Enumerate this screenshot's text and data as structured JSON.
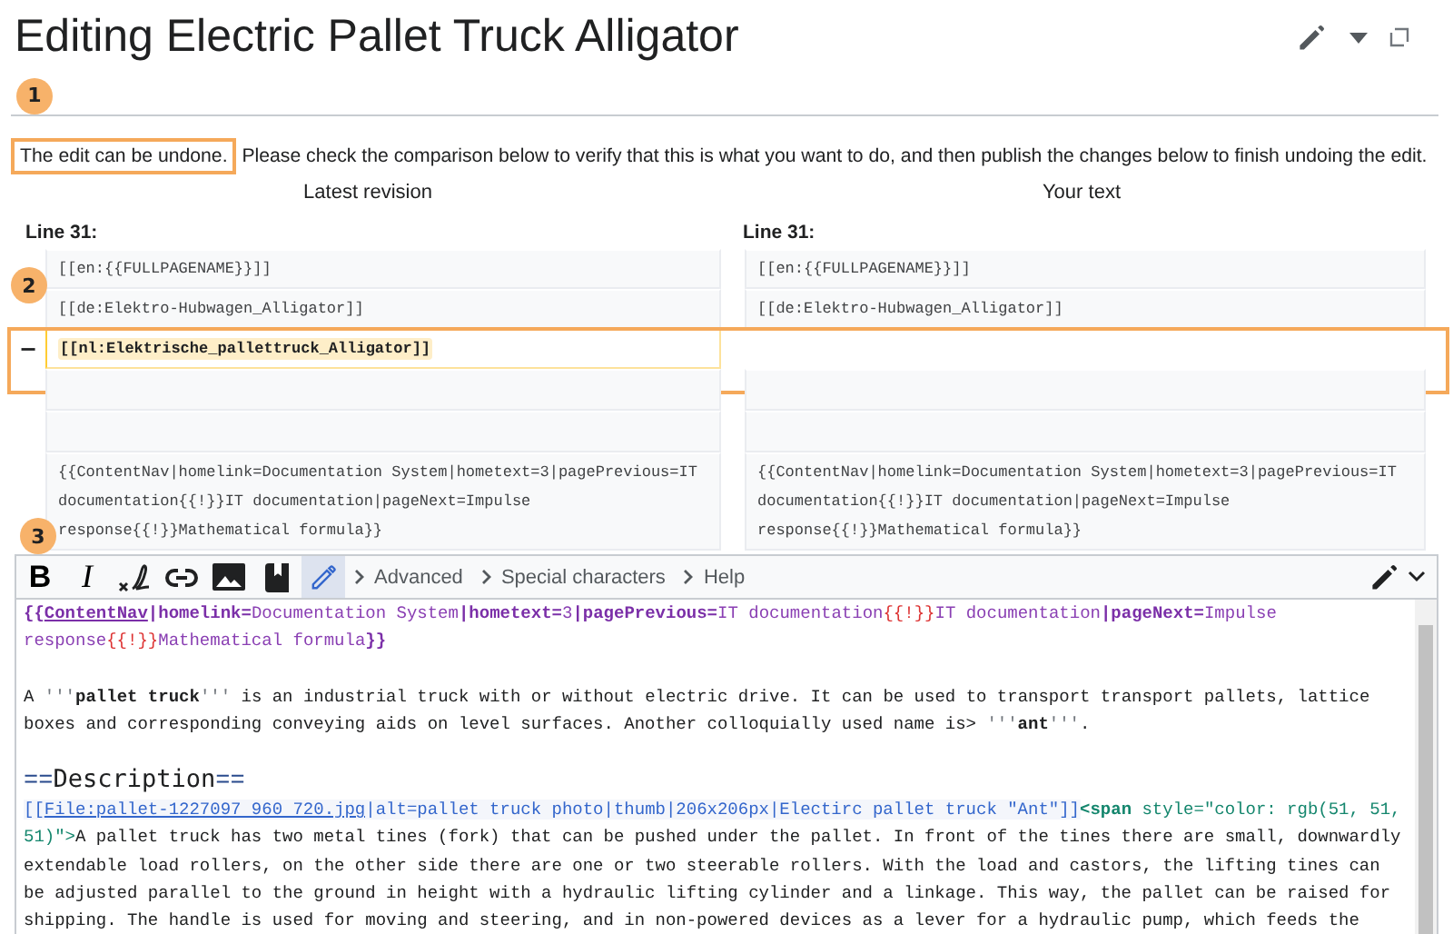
{
  "title": "Editing Electric Pallet Truck Alligator",
  "callouts": [
    "1",
    "2",
    "3"
  ],
  "intro": {
    "highlighted": "The edit can be undone.",
    "rest": "Please check the comparison below to verify that this is what you want to do, and then publish the changes below to finish undoing the edit."
  },
  "diff": {
    "left_heading": "Latest revision",
    "right_heading": "Your text",
    "left_line": "Line 31:",
    "right_line": "Line 31:",
    "rows": [
      {
        "highlight": false,
        "left": {
          "kind": "context",
          "text": "[[en:{{FULLPAGENAME}}]]"
        },
        "right": {
          "kind": "context",
          "text": "[[en:{{FULLPAGENAME}}]]"
        }
      },
      {
        "highlight": false,
        "left": {
          "kind": "context",
          "text": "[[de:Elektro-Hubwagen_Alligator]]"
        },
        "right": {
          "kind": "context",
          "text": "[[de:Elektro-Hubwagen_Alligator]]"
        }
      },
      {
        "highlight": true,
        "marker": "−",
        "left": {
          "kind": "deleted",
          "text": "[[nl:Elektrische_pallettruck_Alligator]]"
        }
      },
      {
        "highlight": false,
        "left": {
          "kind": "blank"
        },
        "right": {
          "kind": "blank"
        }
      },
      {
        "highlight": false,
        "left": {
          "kind": "blank"
        },
        "right": {
          "kind": "blank"
        }
      },
      {
        "highlight": false,
        "left": {
          "kind": "context",
          "text": "{{ContentNav|homelink=Documentation System|hometext=3|pagePrevious=IT documentation{{!}}IT documentation|pageNext=Impulse response{{!}}Mathematical formula}}"
        },
        "right": {
          "kind": "context",
          "text": "{{ContentNav|homelink=Documentation System|hometext=3|pagePrevious=IT documentation{{!}}IT documentation|pageNext=Impulse response{{!}}Mathematical formula}}"
        }
      }
    ]
  },
  "toolbar": {
    "tools": [
      {
        "kind": "bold",
        "label": "B",
        "selected": false
      },
      {
        "kind": "italic",
        "label": "I",
        "selected": false
      },
      {
        "kind": "signature",
        "selected": false
      },
      {
        "kind": "link",
        "selected": false
      },
      {
        "kind": "image",
        "selected": false
      },
      {
        "kind": "reference",
        "selected": false
      },
      {
        "kind": "pencil",
        "selected": true
      }
    ],
    "sections": [
      "Advanced",
      "Special characters",
      "Help"
    ]
  },
  "editor": {
    "blocks": [
      {
        "lines": [
          [
            {
              "kind": "tmpl",
              "text": "{{"
            },
            {
              "kind": "tmplname",
              "text": "ContentNav"
            },
            {
              "kind": "tmpl",
              "text": "|"
            },
            {
              "kind": "param",
              "text": "homelink="
            },
            {
              "kind": "val",
              "text": "Documentation System"
            },
            {
              "kind": "tmpl",
              "text": "|"
            },
            {
              "kind": "param",
              "text": "hometext="
            },
            {
              "kind": "val",
              "text": "3"
            },
            {
              "kind": "tmpl",
              "text": "|"
            },
            {
              "kind": "param",
              "text": "pagePrevious="
            },
            {
              "kind": "val",
              "text": "IT documentation"
            },
            {
              "kind": "sym",
              "text": "{{!}}"
            },
            {
              "kind": "val",
              "text": "IT documentation"
            },
            {
              "kind": "tmpl",
              "text": "|"
            },
            {
              "kind": "param",
              "text": "pageNext="
            },
            {
              "kind": "val",
              "text": "Impulse"
            }
          ],
          [
            {
              "kind": "val",
              "text": "response"
            },
            {
              "kind": "sym",
              "text": "{{!}}"
            },
            {
              "kind": "val",
              "text": "Mathematical formula"
            },
            {
              "kind": "tmpl",
              "text": "}}"
            }
          ]
        ]
      },
      {
        "lines": [
          [
            {
              "kind": "plain",
              "text": "A "
            },
            {
              "kind": "quote",
              "text": "'''"
            },
            {
              "kind": "bold",
              "text": "pallet truck"
            },
            {
              "kind": "quote",
              "text": "'''"
            },
            {
              "kind": "plain",
              "text": " is an industrial truck with or without electric drive. It can be used to transport transport pallets, lattice"
            }
          ],
          [
            {
              "kind": "plain",
              "text": "boxes and corresponding conveying aids on level surfaces. Another colloquially used name is> "
            },
            {
              "kind": "quote",
              "text": "'''"
            },
            {
              "kind": "bold",
              "text": "ant"
            },
            {
              "kind": "quote",
              "text": "'''"
            },
            {
              "kind": "plain",
              "text": "."
            }
          ]
        ]
      },
      {
        "lines": [
          [
            {
              "kind": "hmark",
              "text": "=="
            },
            {
              "kind": "heading",
              "text": "Description"
            },
            {
              "kind": "hmark",
              "text": "=="
            }
          ],
          [
            {
              "kind": "link",
              "text": "[["
            },
            {
              "kind": "linkname",
              "text": "File:pallet-1227097 960 720.jpg"
            },
            {
              "kind": "link",
              "text": "|alt=pallet truck photo|thumb|206x206px|Electirc pallet truck \"Ant\"]]"
            },
            {
              "kind": "tag",
              "text": "<span"
            },
            {
              "kind": "attr",
              "text": " style=\"color: rgb(51, 51,"
            }
          ],
          [
            {
              "kind": "attr",
              "text": "51)\">"
            },
            {
              "kind": "plain",
              "text": "A pallet truck has two metal tines (fork) that can be pushed under the pallet. In front of the tines there are small, downwardly"
            }
          ],
          [
            {
              "kind": "plain",
              "text": "extendable load rollers, on the other side there are one or two steerable rollers. With the load and castors, the lifting tines can"
            }
          ],
          [
            {
              "kind": "plain",
              "text": "be adjusted parallel to the ground in height with a hydraulic lifting cylinder and a linkage. This way, the pallet can be raised for"
            }
          ],
          [
            {
              "kind": "plain",
              "text": "shipping. The handle is used for moving and steering, and in non-powered devices as a lever for a hydraulic pump, which feeds the"
            }
          ]
        ]
      }
    ]
  }
}
